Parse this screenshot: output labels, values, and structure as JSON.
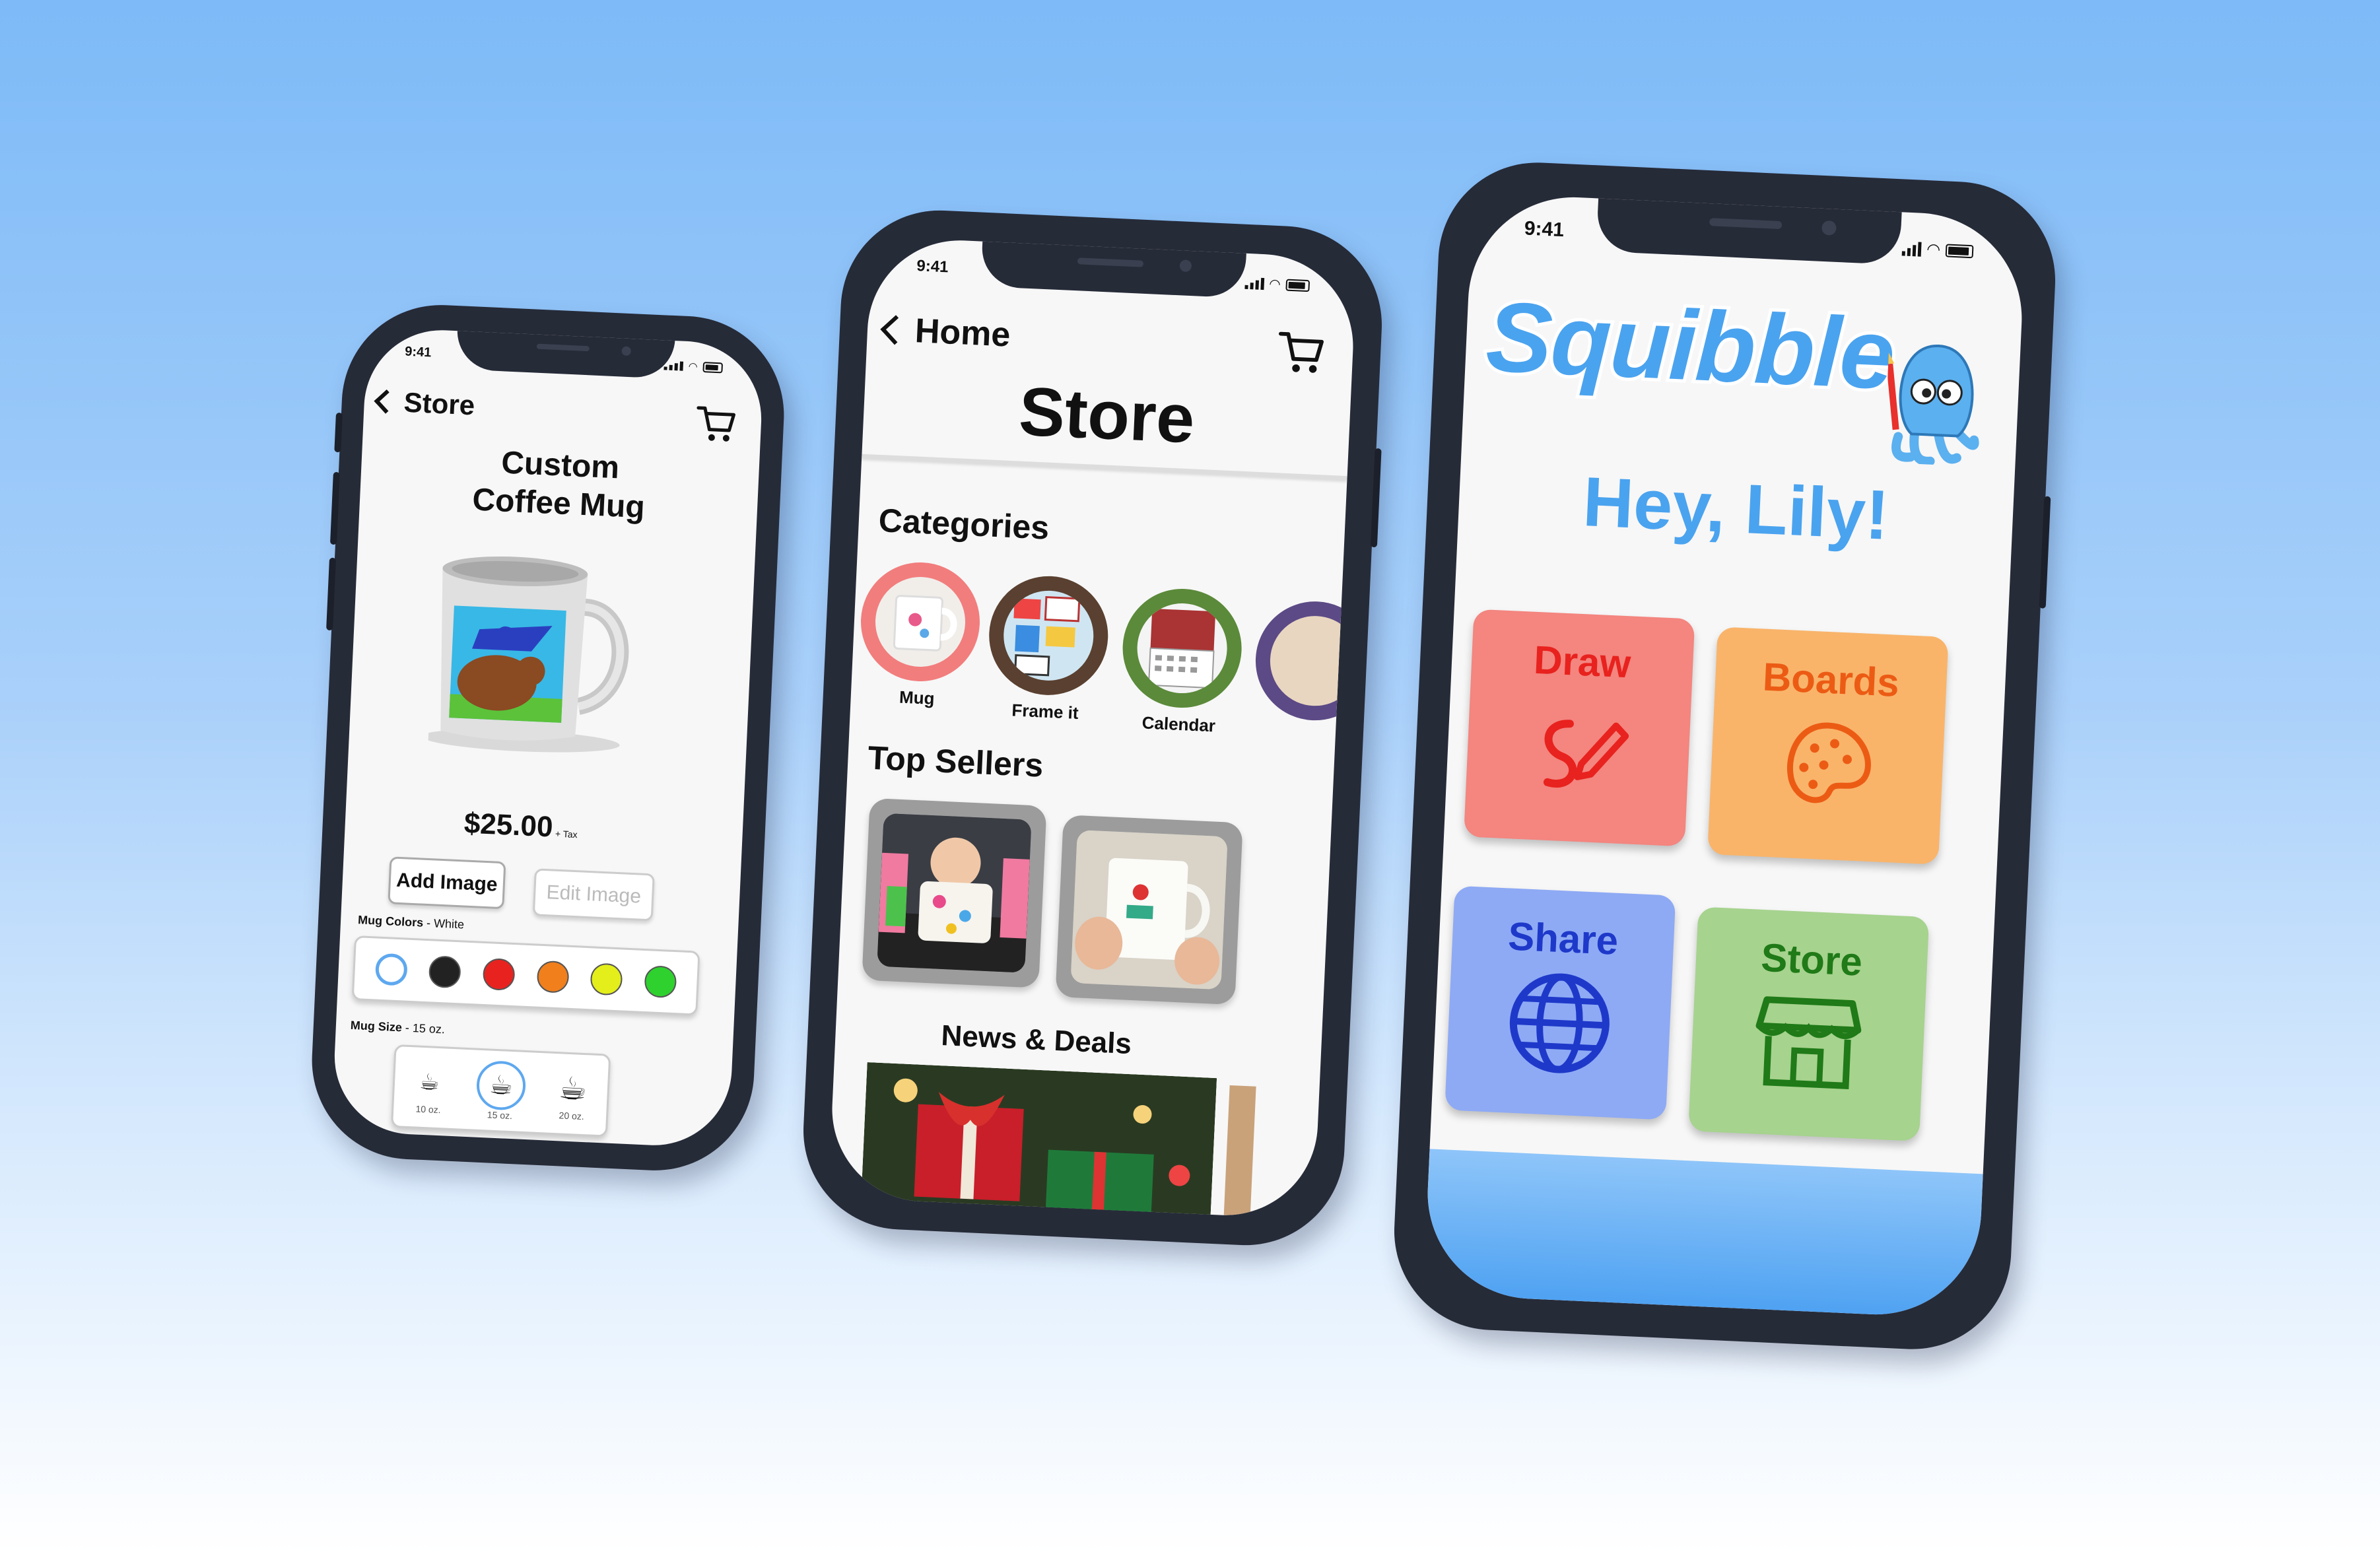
{
  "status": {
    "time": "9:41"
  },
  "product_screen": {
    "back_label": "Store",
    "title_line1": "Custom",
    "title_line2": "Coffee Mug",
    "price": "$25.00",
    "price_suffix": "+ Tax",
    "add_image_label": "Add Image",
    "edit_image_label": "Edit Image",
    "colors_label": "Mug Colors",
    "colors_value": "- White",
    "colors": [
      "#ffffff",
      "#222222",
      "#e8231f",
      "#f07f1c",
      "#e3ee1a",
      "#2fd12f"
    ],
    "size_label": "Mug Size",
    "size_value": "- 15 oz.",
    "sizes": [
      "10 oz.",
      "15 oz.",
      "20 oz."
    ]
  },
  "store_screen": {
    "back_label": "Home",
    "title": "Store",
    "categories_heading": "Categories",
    "categories": [
      {
        "label": "Mug",
        "ring": "#f27d7d"
      },
      {
        "label": "Frame it",
        "ring": "#5a4030"
      },
      {
        "label": "Calendar",
        "ring": "#5b8a3a"
      },
      {
        "label": "",
        "ring": "#5c4a86"
      }
    ],
    "top_sellers_heading": "Top Sellers",
    "news_heading": "News & Deals"
  },
  "home_screen": {
    "logo": "Squibble",
    "greeting": "Hey, Lily!",
    "tiles": [
      {
        "label": "Draw",
        "bg": "#f4857f",
        "fg": "#e8221e",
        "icon": "pencil-scribble-icon"
      },
      {
        "label": "Boards",
        "bg": "#f9b46a",
        "fg": "#ec5b14",
        "icon": "palette-icon"
      },
      {
        "label": "Share",
        "bg": "#8eaaf5",
        "fg": "#1e39c9",
        "icon": "globe-icon"
      },
      {
        "label": "Store",
        "bg": "#a6d38e",
        "fg": "#1f7a17",
        "icon": "storefront-icon"
      }
    ]
  }
}
